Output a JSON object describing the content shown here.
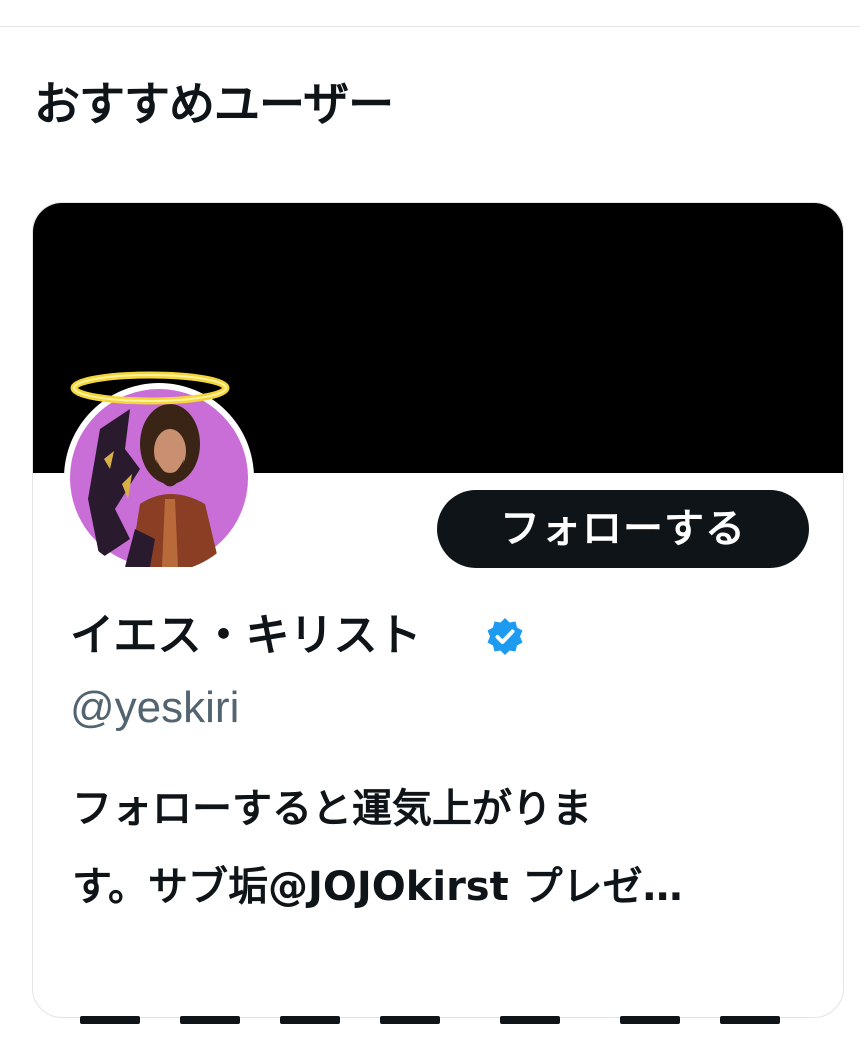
{
  "section": {
    "title": "おすすめユーザー"
  },
  "user_card": {
    "display_name": "イエス・キリスト",
    "handle": "@yeskiri",
    "follow_button_label": "フォローする",
    "bio_lines": [
      "フォローすると運気上がりま",
      "す。サブ垢@JOJOkirst プレゼ…"
    ],
    "verified_icon": "verified-badge-icon",
    "avatar_icon": "avatar",
    "halo_icon": "halo-icon"
  },
  "colors": {
    "follow_button_bg": "#0f1419",
    "banner": "#000000",
    "verified_blue": "#1d9bf0",
    "handle_gray": "#536471",
    "avatar_bg": "#c86ed6",
    "halo": "#f5d63a"
  }
}
